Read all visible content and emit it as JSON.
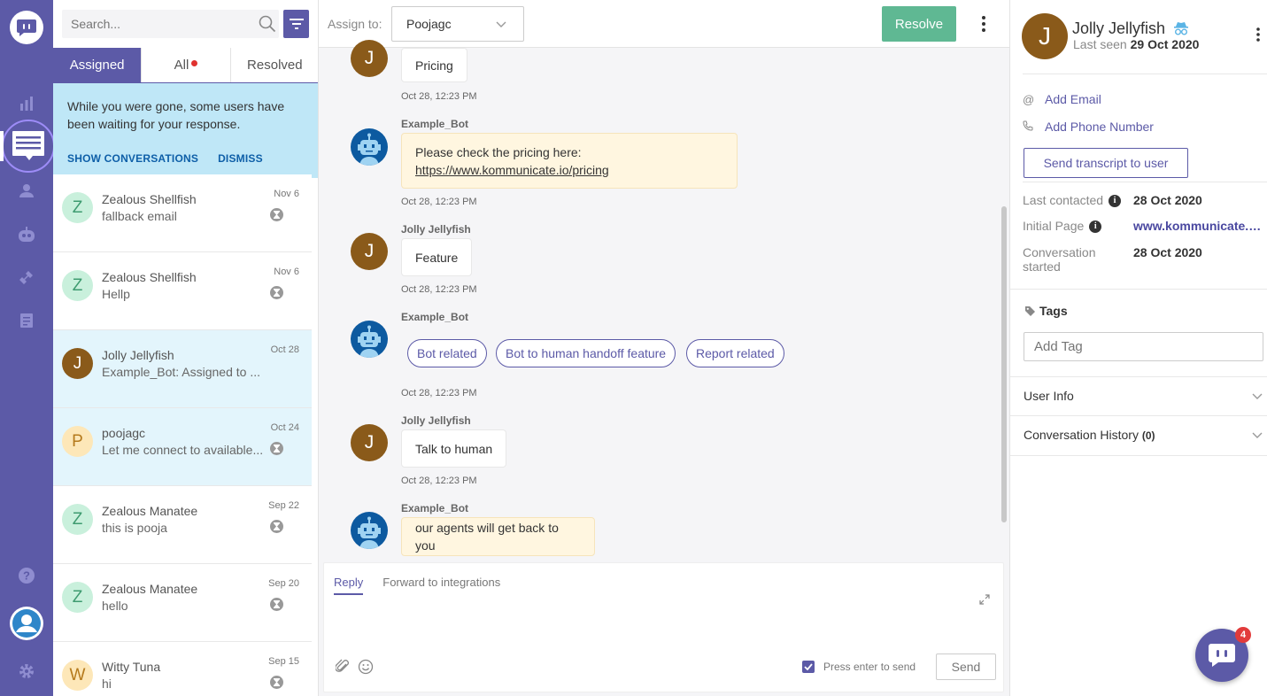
{
  "colors": {
    "brand": "#5c5aa7",
    "resolve": "#5fb893",
    "notice_bg": "#bfe7f7",
    "bot_bubble": "#fff6e0",
    "unread_dot": "#e0322f"
  },
  "rail": {
    "icons": [
      "logo-icon",
      "reports-icon",
      "conversations-icon",
      "users-icon",
      "bot-icon",
      "integrations-icon",
      "faq-icon",
      "help-icon",
      "profile-icon",
      "settings-icon"
    ]
  },
  "list": {
    "search": {
      "placeholder": "Search..."
    },
    "tabs": [
      {
        "label": "Assigned"
      },
      {
        "label": "All"
      },
      {
        "label": "Resolved"
      }
    ],
    "notice": {
      "text": "While you were gone, some users have been waiting for your response.",
      "show_label": "SHOW CONVERSATIONS",
      "dismiss_label": "DISMISS"
    },
    "conversations": [
      {
        "initial": "Z",
        "name": "Zealous Shellfish",
        "preview": "fallback email",
        "date": "Nov 6"
      },
      {
        "initial": "Z",
        "name": "Zealous Shellfish",
        "preview": "Hellp",
        "date": "Nov 6"
      },
      {
        "initial": "J",
        "name": "Jolly Jellyfish",
        "preview": "Example_Bot: Assigned to ...",
        "date": "Oct 28"
      },
      {
        "initial": "P",
        "name": "poojagc",
        "preview": "Let me connect to available...",
        "date": "Oct 24"
      },
      {
        "initial": "Z",
        "name": "Zealous Manatee",
        "preview": "this is pooja",
        "date": "Sep 22"
      },
      {
        "initial": "Z",
        "name": "Zealous Manatee",
        "preview": "hello",
        "date": "Sep 20"
      },
      {
        "initial": "W",
        "name": "Witty Tuna",
        "preview": "hi",
        "date": "Sep 15"
      }
    ]
  },
  "chat": {
    "assign_label": "Assign to:",
    "assignee": "Poojagc",
    "resolve_label": "Resolve",
    "messages": [
      {
        "kind": "user",
        "sender": "",
        "avatar": "J",
        "text": "Pricing",
        "time": "Oct 28, 12:23 PM"
      },
      {
        "kind": "bot",
        "sender": "Example_Bot",
        "text": "Please check the pricing here:",
        "link": "https://www.kommunicate.io/pricing",
        "time": "Oct 28, 12:23 PM"
      },
      {
        "kind": "user",
        "sender": "Jolly Jellyfish",
        "avatar": "J",
        "text": "Feature",
        "time": "Oct 28, 12:23 PM"
      },
      {
        "kind": "bot-buttons",
        "sender": "Example_Bot",
        "buttons": [
          "Bot related",
          "Bot to human handoff feature",
          "Report related"
        ],
        "time": "Oct 28, 12:23 PM"
      },
      {
        "kind": "user",
        "sender": "Jolly Jellyfish",
        "avatar": "J",
        "text": "Talk to human",
        "time": "Oct 28, 12:23 PM"
      },
      {
        "kind": "bot",
        "sender": "Example_Bot",
        "text": "our agents will get back to you"
      }
    ],
    "reply": {
      "tab_reply": "Reply",
      "tab_forward": "Forward to integrations",
      "enter_to_send": "Press enter to send",
      "send_label": "Send"
    }
  },
  "info": {
    "initial": "J",
    "name": "Jolly Jellyfish",
    "last_seen_label": "Last seen",
    "last_seen": "29 Oct 2020",
    "add_email": "Add Email",
    "add_phone": "Add Phone Number",
    "send_transcript": "Send transcript to user",
    "last_contacted_label": "Last contacted",
    "last_contacted": "28 Oct 2020",
    "initial_page_label": "Initial Page",
    "initial_page": "www.kommunicate.io/pricing",
    "conv_started_label": "Conversation started",
    "conv_started": "28 Oct 2020",
    "tags_label": "Tags",
    "tag_placeholder": "Add Tag",
    "user_info_label": "User Info",
    "conv_history_label": "Conversation History",
    "conv_history_count": "(0)"
  },
  "launcher": {
    "badge": "4"
  }
}
